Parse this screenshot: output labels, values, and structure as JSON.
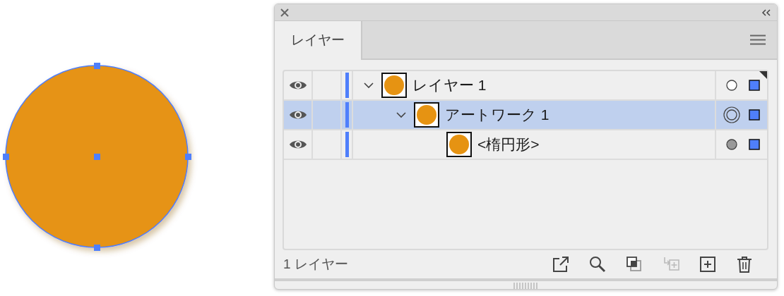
{
  "canvas": {
    "shape": {
      "kind": "ellipse",
      "selected": true
    }
  },
  "panel": {
    "tabs": [
      {
        "label": "レイヤー",
        "selected": true
      }
    ],
    "layers": [
      {
        "name": "レイヤー 1",
        "visible": true,
        "selected": false,
        "current": true,
        "expanded": true,
        "targeted": false,
        "filled": false,
        "color": "#4f7ffb",
        "children": [
          {
            "name": "アートワーク 1",
            "visible": true,
            "selected": true,
            "current": false,
            "expanded": true,
            "targeted": true,
            "filled": false,
            "color": "#4f7ffb",
            "children": [
              {
                "name": "<楕円形>",
                "visible": true,
                "selected": false,
                "current": false,
                "targeted": false,
                "filled": true,
                "color": "#4f7ffb"
              }
            ]
          }
        ]
      }
    ],
    "status": "1 レイヤー",
    "footer_buttons": [
      {
        "kind": "export",
        "disabled": false
      },
      {
        "kind": "search",
        "disabled": false
      },
      {
        "kind": "clip",
        "disabled": false
      },
      {
        "kind": "move",
        "disabled": true
      },
      {
        "kind": "new",
        "disabled": false
      },
      {
        "kind": "delete",
        "disabled": false
      }
    ]
  }
}
